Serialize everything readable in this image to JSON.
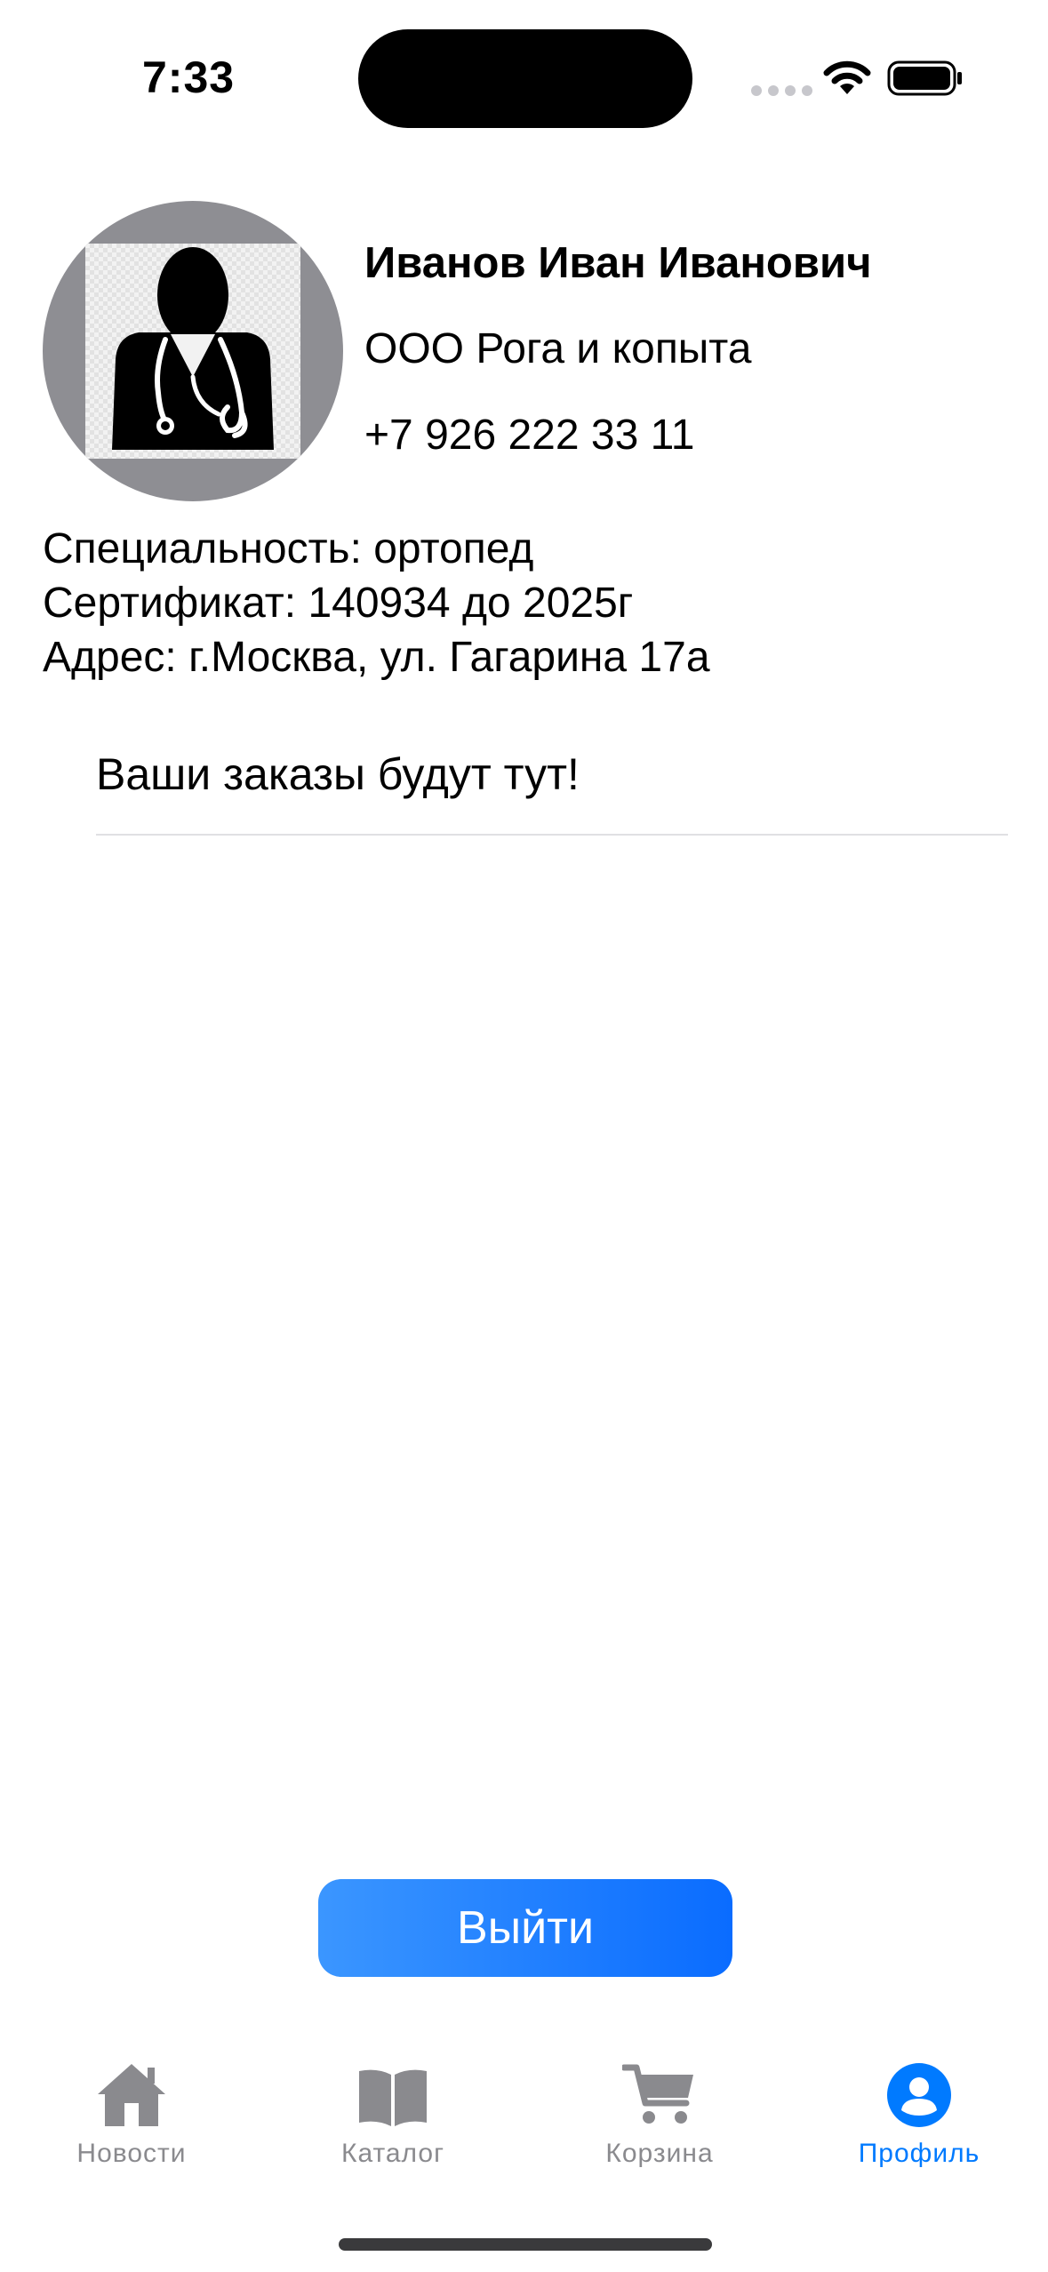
{
  "status_bar": {
    "time": "7:33"
  },
  "profile": {
    "name": "Иванов Иван Иванович",
    "company": "ООО Рога и копыта",
    "phone": "+7 926 222 33 11",
    "avatar_icon": "doctor-icon"
  },
  "details": {
    "specialty": "Специальность: ортопед",
    "certificate": "Сертификат: 140934 до 2025г",
    "address": "Адрес: г.Москва, ул. Гагарина 17а"
  },
  "orders": {
    "placeholder": "Ваши заказы будут тут!"
  },
  "logout_label": "Выйти",
  "tab_bar": {
    "tabs": [
      {
        "label": "Новости",
        "icon": "house-icon",
        "active": false
      },
      {
        "label": "Каталог",
        "icon": "book-icon",
        "active": false
      },
      {
        "label": "Корзина",
        "icon": "cart-icon",
        "active": false
      },
      {
        "label": "Профиль",
        "icon": "person-circle-icon",
        "active": true
      }
    ]
  },
  "colors": {
    "accent": "#007aff",
    "inactive_tab": "#8a8a8e",
    "avatar_ring": "#8e8e93"
  }
}
